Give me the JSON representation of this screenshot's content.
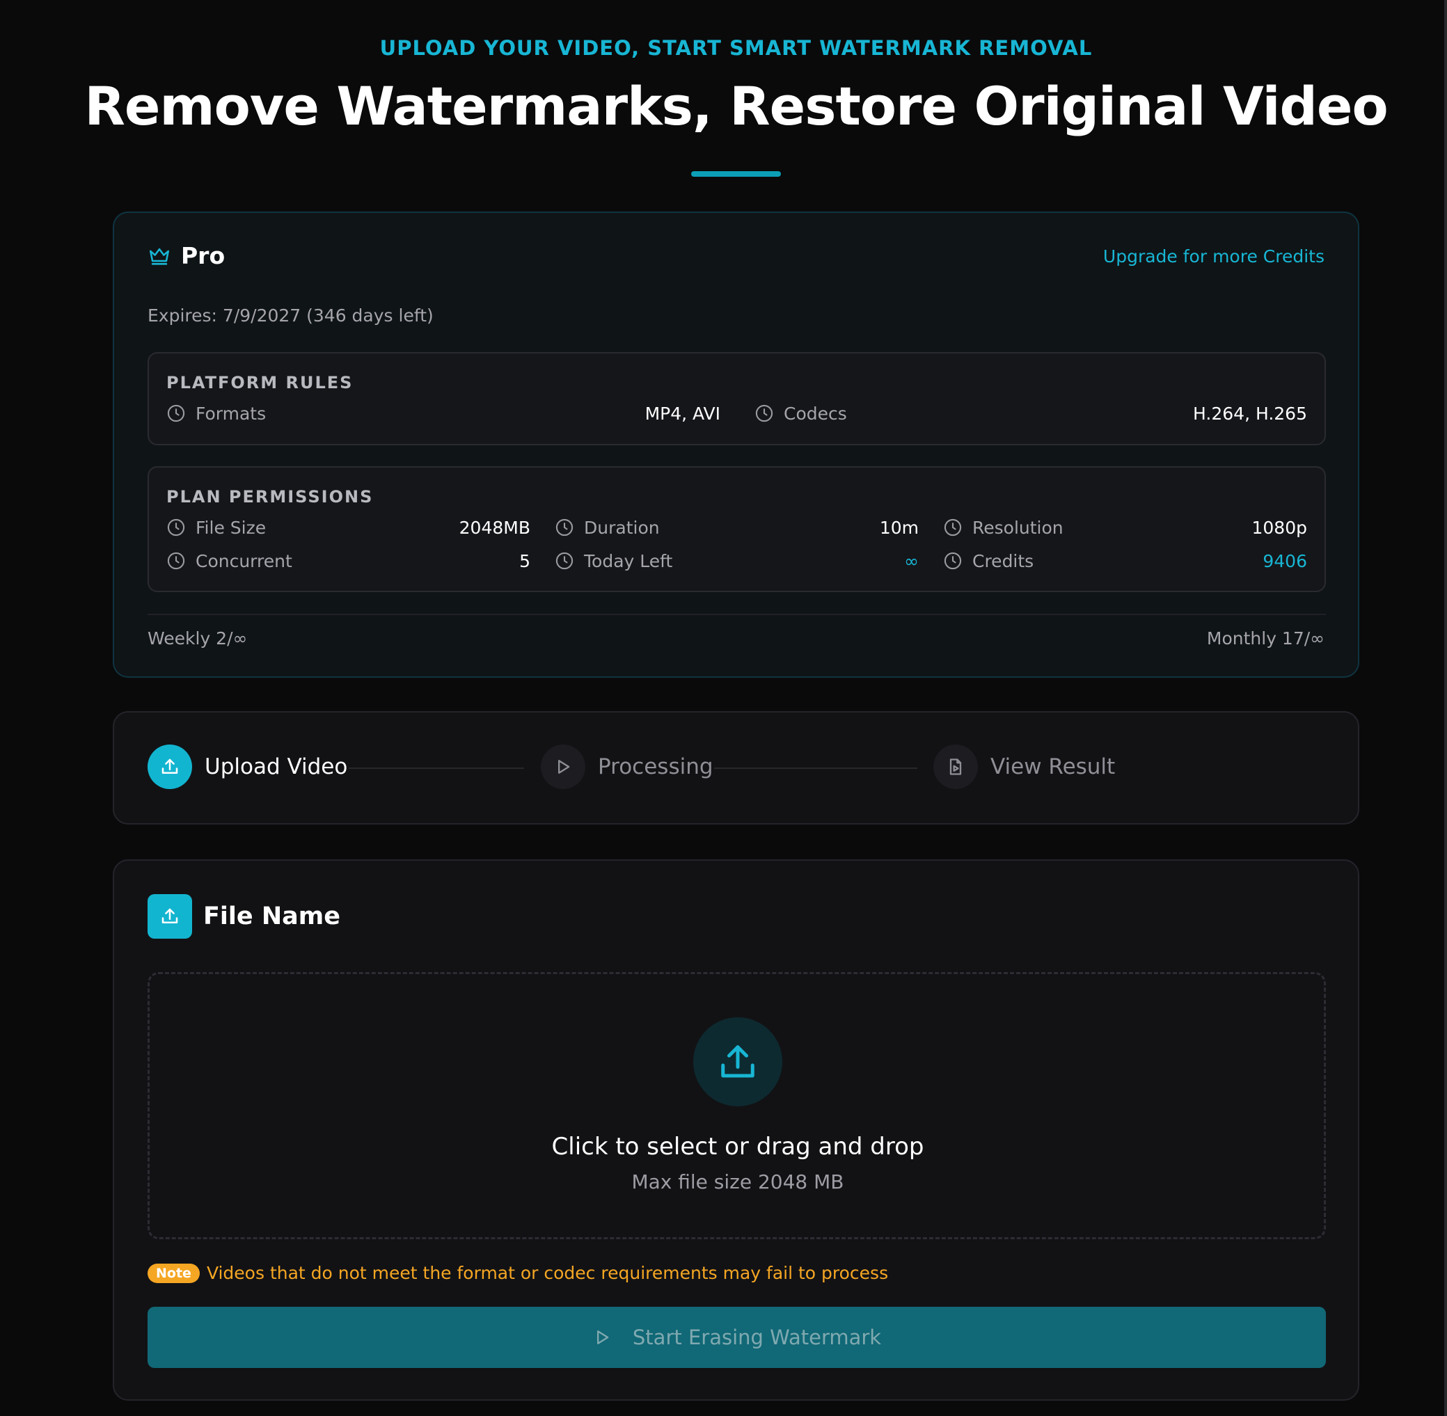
{
  "header": {
    "eyebrow": "UPLOAD YOUR VIDEO, START SMART WATERMARK REMOVAL",
    "title": "Remove Watermarks, Restore Original Video"
  },
  "plan": {
    "name": "Pro",
    "upgrade_label": "Upgrade for more Credits",
    "expires": "Expires: 7/9/2027 (346 days left)",
    "platform_rules": {
      "title": "PLATFORM RULES",
      "items": [
        {
          "label": "Formats",
          "value": "MP4, AVI"
        },
        {
          "label": "Codecs",
          "value": "H.264, H.265"
        }
      ]
    },
    "plan_permissions": {
      "title": "PLAN PERMISSIONS",
      "items": [
        {
          "label": "File Size",
          "value": "2048MB"
        },
        {
          "label": "Duration",
          "value": "10m"
        },
        {
          "label": "Resolution",
          "value": "1080p"
        },
        {
          "label": "Concurrent",
          "value": "5"
        },
        {
          "label": "Today Left",
          "value": "∞"
        },
        {
          "label": "Credits",
          "value": "9406"
        }
      ]
    },
    "weekly": "Weekly 2/∞",
    "monthly": "Monthly 17/∞"
  },
  "steps": [
    {
      "label": "Upload Video",
      "icon": "upload-icon",
      "state": "active"
    },
    {
      "label": "Processing",
      "icon": "play-icon",
      "state": "inactive"
    },
    {
      "label": "View Result",
      "icon": "file-video-icon",
      "state": "inactive"
    }
  ],
  "upload": {
    "title": "File Name",
    "drop_main": "Click to select or drag and drop",
    "drop_sub": "Max file size 2048 MB",
    "note_badge": "Note",
    "note_text": "Videos that do not meet the format or codec requirements may fail to process",
    "start_label": "Start Erasing Watermark"
  },
  "colors": {
    "accent": "#18b6d4",
    "background": "#0a0a0b",
    "note": "#f5a623",
    "button": "#116876"
  }
}
